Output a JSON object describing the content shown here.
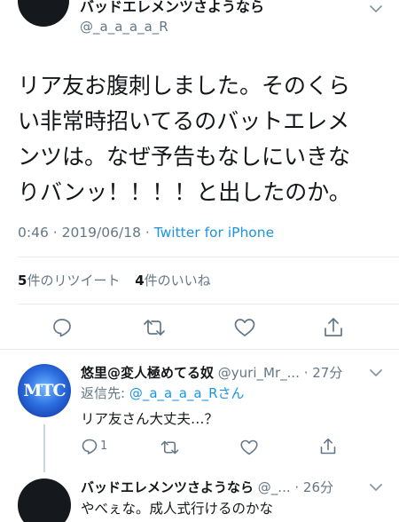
{
  "main_tweet": {
    "display_name": "バッドエレメンツさようなら",
    "handle": "@_a_a_a_a_R",
    "text_lines": [
      "リア友お腹刺しました。そのくら",
      "い非常時招いてるのバットエレメ",
      "ンツは。なぜ予告もなしにいきな",
      "りバンッ！！！！と出したのか。"
    ],
    "time": "0:46 · 2019/06/18 · ",
    "source": "Twitter for iPhone",
    "retweet_count": "5",
    "retweet_label": "件のリツイート",
    "like_count": "4",
    "like_label": "件のいいね"
  },
  "reply1": {
    "avatar_text": "MTC",
    "display_name": "悠里@変人極めてる奴",
    "handle": "@yuri_Mr_...",
    "time": "· 27分",
    "reply_prefix": "返信先: ",
    "reply_to": "@_a_a_a_a_Rさん",
    "text": "リア友さん大丈夫…？",
    "reply_count": "1"
  },
  "reply2": {
    "display_name": "バッドエレメンツさようなら",
    "handle": "@_...",
    "time": "· 26分",
    "text": "やべぇな。成人式行けるのかな"
  },
  "icons": [
    "chevron-down-icon",
    "reply-icon",
    "retweet-icon",
    "like-icon",
    "share-icon"
  ],
  "colors": {
    "accent": "#1b95e0",
    "muted": "#657786",
    "divider": "#e6ecf0",
    "avatar": "#15181c"
  }
}
